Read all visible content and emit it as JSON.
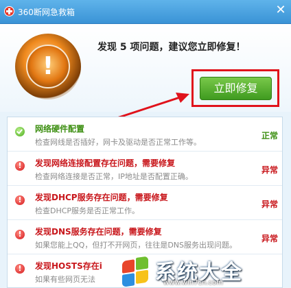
{
  "window": {
    "title": "360断网急救箱",
    "close_glyph": "✕"
  },
  "hero": {
    "badge_glyph": "!",
    "message": "发现 5 项问题，建议您立即修复！",
    "fix_button_label": "立即修复"
  },
  "colors": {
    "ok": "#3d8f12",
    "error": "#c8161b",
    "highlight_frame": "#e0121b",
    "fix_button": "#4fa82a"
  },
  "items": [
    {
      "title": "网络硬件配置",
      "desc": "检查网线是否插好，网卡及驱动是否正常工作等。",
      "status": "正常",
      "icon": "check-icon"
    },
    {
      "title": "发现网络连接配置存在问题，需要修复",
      "desc": "检查网络连接是否正常，IP地址是否配置正确。",
      "status": "异常",
      "icon": "error-icon"
    },
    {
      "title": "发现DHCP服务存在问题，需要修复",
      "desc": "检查DHCP服务是否正常工作。",
      "status": "异常",
      "icon": "error-icon"
    },
    {
      "title": "发现DNS服务存在问题，需要修复",
      "desc": "如果您能上QQ，但打不开网页，往往是DNS服务出现问题。",
      "status": "异常",
      "icon": "error-icon"
    },
    {
      "title": "发现HOSTS存在i",
      "desc": "如果有些网页无法",
      "status": "",
      "icon": "error-icon"
    }
  ],
  "watermark": {
    "text": "系统大全",
    "url": "www.win7cn.com"
  }
}
